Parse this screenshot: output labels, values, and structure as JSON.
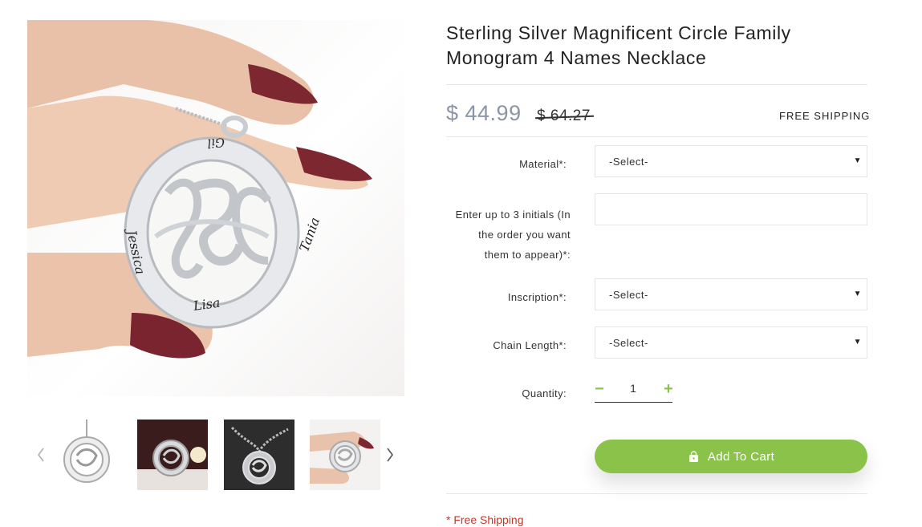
{
  "product": {
    "title_line1": "Sterling Silver Magnificent Circle Family",
    "title_line2": "Monogram 4 Names Necklace",
    "price_current": "$ 44.99",
    "price_old": "$ 64.27",
    "shipping_tag": "FREE SHIPPING",
    "pendant_names": [
      "Gil",
      "Jessica",
      "Tania",
      "Lisa"
    ]
  },
  "options": {
    "material": {
      "label": "Material*:",
      "value": "-Select-"
    },
    "initials": {
      "label_line1": "Enter up to 3 initials (In",
      "label_line2": "the order you want",
      "label_line3": "them to appear)*:",
      "value": ""
    },
    "inscription": {
      "label": "Inscription*:",
      "value": "-Select-"
    },
    "chain_length": {
      "label": "Chain Length*:",
      "value": "-Select-"
    },
    "quantity": {
      "label": "Quantity:",
      "value": "1",
      "minus": "−",
      "plus": "+"
    }
  },
  "cart": {
    "add_label": "Add To Cart"
  },
  "note": "* Free Shipping",
  "colors": {
    "accent_green": "#8bc34a",
    "price_grey": "#8a95a5",
    "note_red": "#c0392b"
  },
  "icons": [
    "chevron-left-icon",
    "chevron-right-icon",
    "shopping-bag-icon",
    "caret-down-icon"
  ]
}
